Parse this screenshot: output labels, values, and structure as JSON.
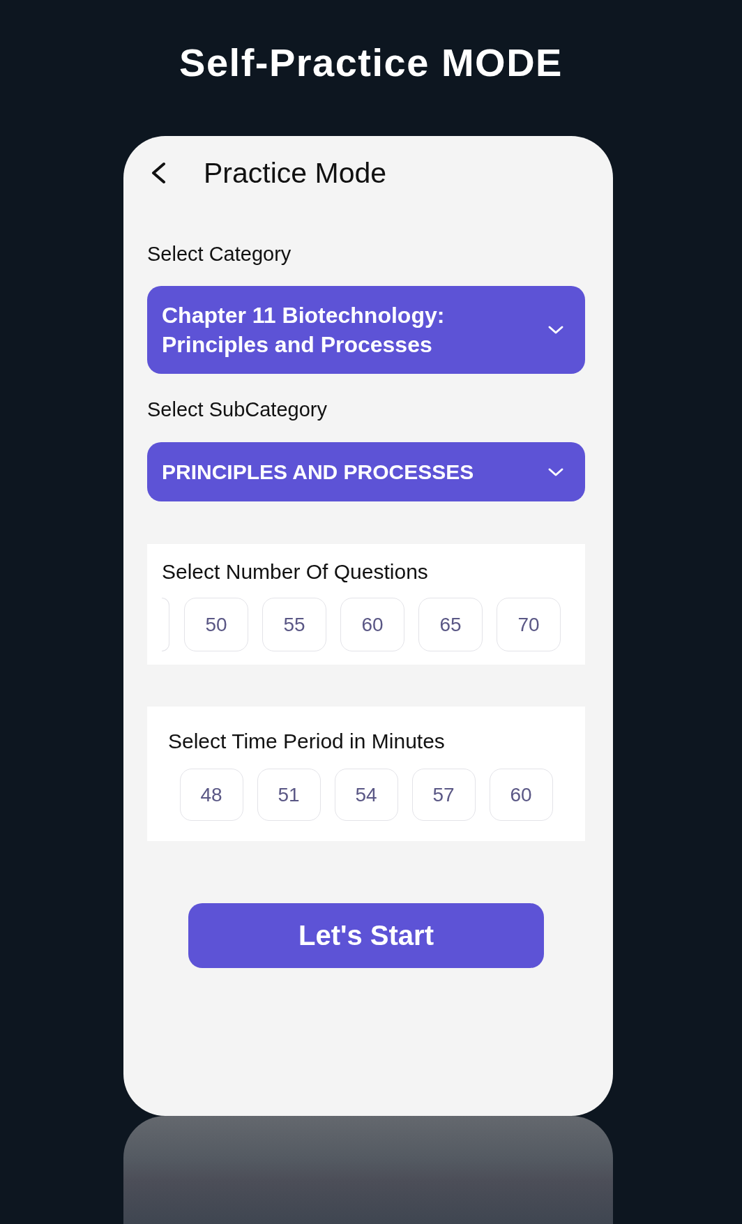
{
  "page_title": "Self-Practice MODE",
  "screen": {
    "title": "Practice Mode"
  },
  "category": {
    "label": "Select Category",
    "value": "Chapter 11 Biotechnology: Principles and Processes"
  },
  "subcategory": {
    "label": "Select SubCategory",
    "value": "PRINCIPLES AND PROCESSES"
  },
  "question_count": {
    "label": "Select Number Of Questions",
    "scrolled": true,
    "options": [
      {
        "label": "50",
        "selected": false
      },
      {
        "label": "55",
        "selected": false
      },
      {
        "label": "60",
        "selected": false
      },
      {
        "label": "65",
        "selected": false
      },
      {
        "label": "70",
        "selected": false
      }
    ]
  },
  "time_period": {
    "label": "Select Time Period in Minutes",
    "options": [
      {
        "label": "48",
        "selected": false
      },
      {
        "label": "51",
        "selected": false
      },
      {
        "label": "54",
        "selected": false
      },
      {
        "label": "57",
        "selected": false
      },
      {
        "label": "60",
        "selected": false
      }
    ]
  },
  "start_button": {
    "label": "Let's Start"
  }
}
